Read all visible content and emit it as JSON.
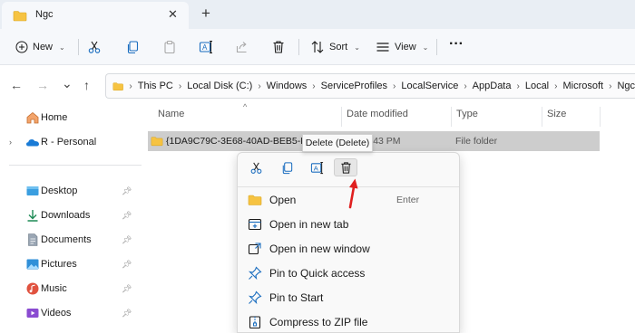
{
  "window": {
    "tab_title": "Ngc",
    "close_glyph": "✕",
    "new_tab_glyph": "+"
  },
  "toolbar": {
    "new_label": "New",
    "sort_label": "Sort",
    "view_label": "View",
    "more_label": "···",
    "icons": [
      "cut-icon",
      "copy-icon",
      "paste-icon",
      "rename-icon",
      "share-icon",
      "delete-icon",
      "sort-icon",
      "view-icon"
    ]
  },
  "address": {
    "crumbs": [
      "This PC",
      "Local Disk (C:)",
      "Windows",
      "ServiceProfiles",
      "LocalService",
      "AppData",
      "Local",
      "Microsoft",
      "Ngc"
    ],
    "separator": "›"
  },
  "nav": {
    "back": "←",
    "forward": "→",
    "recent": "⌄",
    "up": "↑"
  },
  "sidebar": {
    "items": [
      {
        "label": "Home",
        "icon": "home-icon"
      },
      {
        "label": "R - Personal",
        "icon": "onedrive-icon"
      },
      {
        "label": "Desktop",
        "icon": "desktop-icon"
      },
      {
        "label": "Downloads",
        "icon": "downloads-icon"
      },
      {
        "label": "Documents",
        "icon": "documents-icon"
      },
      {
        "label": "Pictures",
        "icon": "pictures-icon"
      },
      {
        "label": "Music",
        "icon": "music-icon"
      },
      {
        "label": "Videos",
        "icon": "videos-icon"
      }
    ],
    "pin_glyph": "📌",
    "expander_glyph": "›"
  },
  "columns": {
    "name": "Name",
    "date": "Date modified",
    "type": "Type",
    "size": "Size",
    "sort_glyph": "^"
  },
  "file": {
    "name": "{1DA9C79C-3E68-40AD-BEB5-F44",
    "date": "022 4:43 PM",
    "type": "File folder"
  },
  "tooltip": "Delete (Delete)",
  "context_menu": {
    "items": [
      {
        "label": "Open",
        "shortcut": "Enter",
        "icon": "folder-icon"
      },
      {
        "label": "Open in new tab",
        "shortcut": "",
        "icon": "new-tab-icon"
      },
      {
        "label": "Open in new window",
        "shortcut": "",
        "icon": "new-window-icon"
      },
      {
        "label": "Pin to Quick access",
        "shortcut": "",
        "icon": "pin-icon"
      },
      {
        "label": "Pin to Start",
        "shortcut": "",
        "icon": "pin-start-icon"
      },
      {
        "label": "Compress to ZIP file",
        "shortcut": "",
        "icon": "zip-icon"
      }
    ]
  },
  "colors": {
    "accent": "#0067c0",
    "folder": "#f6c342",
    "annotation": "#e02020"
  }
}
